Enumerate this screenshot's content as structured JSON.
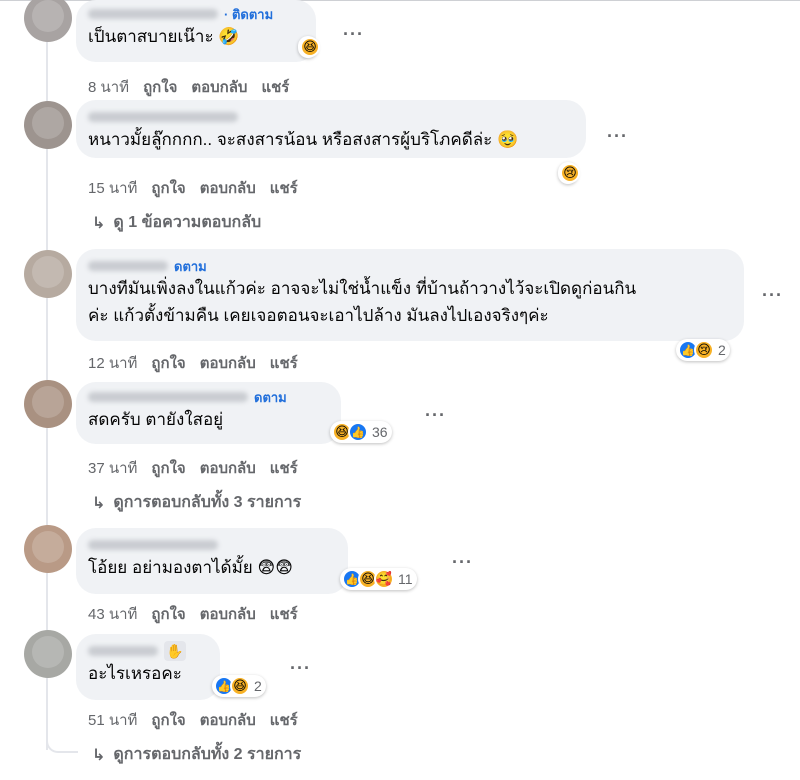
{
  "follow_label": "· ติดตาม",
  "follow_label_short": "ดตาม",
  "action_like": "ถูกใจ",
  "action_reply": "ตอบกลับ",
  "action_share": "แชร์",
  "more_label": "···",
  "comments": [
    {
      "text": "เป็นตาสบายเน๊าะ 🤣",
      "time": "8 นาที",
      "reactions": [
        "haha"
      ],
      "reaction_count": ""
    },
    {
      "text": "หนาวมั้ยลู๊กกกก.. จะสงสารน้อน หรือสงสารผู้บริโภคดีล่ะ 🥹",
      "time": "15 นาที",
      "reactions": [
        "sad"
      ],
      "reaction_count": "",
      "replies_label": "ดู 1 ข้อความตอบกลับ"
    },
    {
      "text_line1": "บางทีมันเพิ่งลงในแก้วค่ะ อาจจะไม่ใช่น้ำแข็ง ที่บ้านถ้าวางไว้จะเปิดดูก่อนกิน",
      "text_line2": "ค่ะ แก้วตั้งข้ามคืน เคยเจอตอนจะเอาไปล้าง มันลงไปเองจริงๆค่ะ",
      "time": "12 นาที",
      "reactions": [
        "like",
        "sad"
      ],
      "reaction_count": "2"
    },
    {
      "text": "สดครับ ตายังใสอยู่",
      "time": "37 นาที",
      "reactions": [
        "haha",
        "like"
      ],
      "reaction_count": "36",
      "replies_label": "ดูการตอบกลับทั้ง 3 รายการ"
    },
    {
      "text": "โอ้ยย อย่ามองตาได้มั้ย 😨😨",
      "time": "43 นาที",
      "reactions": [
        "like",
        "haha",
        "care"
      ],
      "reaction_count": "11"
    },
    {
      "text": "อะไรเหรอคะ",
      "time": "51 นาที",
      "reactions": [
        "like",
        "haha"
      ],
      "reaction_count": "2",
      "replies_label": "ดูการตอบกลับทั้ง 2 รายการ"
    }
  ],
  "icons": {
    "reply_arrow": "reply-arrow-icon",
    "like": "like-icon",
    "haha": "haha-icon",
    "sad": "sad-icon",
    "care": "care-icon",
    "wave_badge": "wave-badge-icon"
  }
}
